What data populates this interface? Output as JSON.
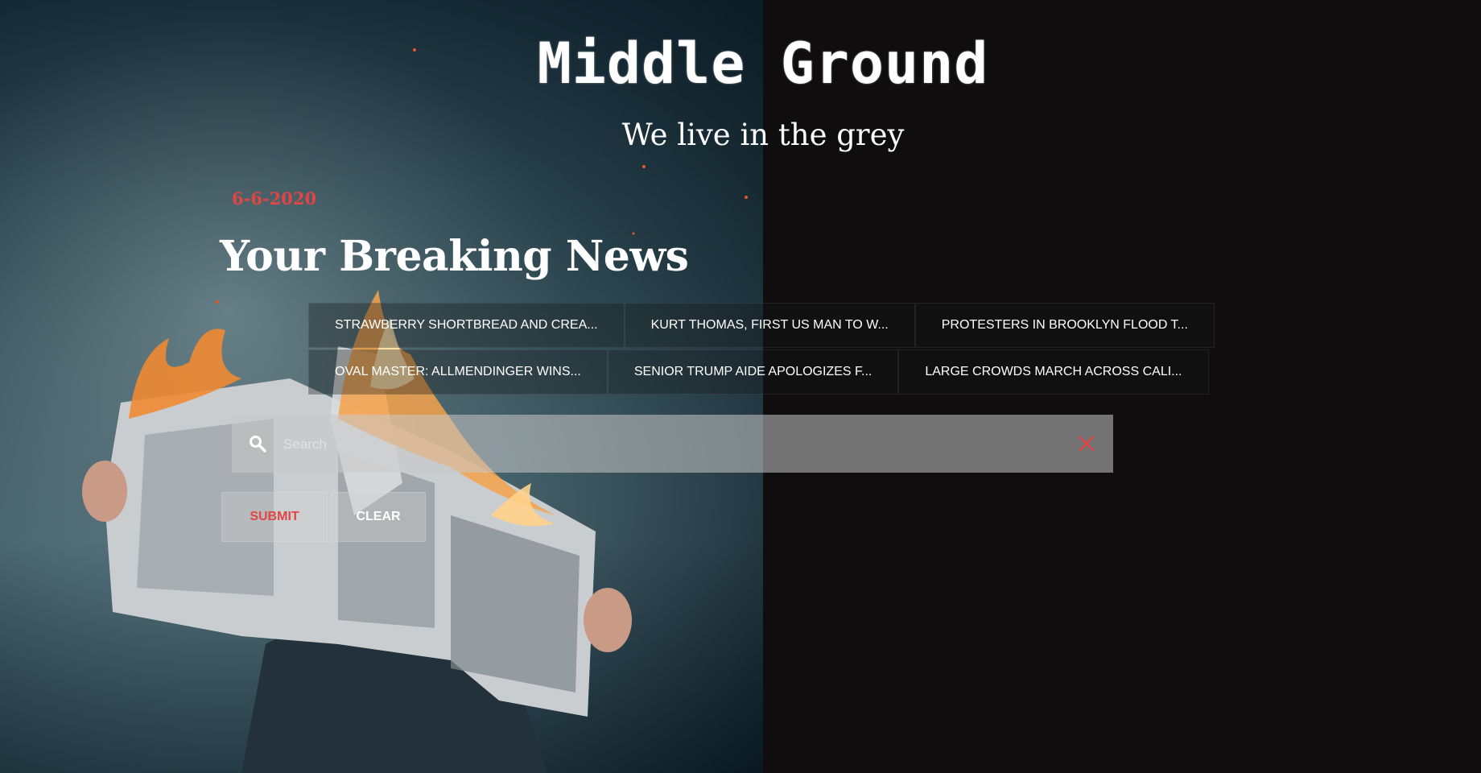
{
  "site": {
    "title": "Middle Ground",
    "subtitle": "We live in the grey"
  },
  "date": "6-6-2020",
  "heading": "Your Breaking News",
  "news": {
    "row1": [
      "STRAWBERRY SHORTBREAD AND CREA...",
      "KURT THOMAS, FIRST US MAN TO W...",
      "PROTESTERS IN BROOKLYN FLOOD T..."
    ],
    "row2": [
      "OVAL MASTER: ALLMENDINGER WINS...",
      "SENIOR TRUMP AIDE APOLOGIZES F...",
      "LARGE CROWDS MARCH ACROSS CALI..."
    ]
  },
  "search": {
    "placeholder": "Search",
    "value": ""
  },
  "buttons": {
    "submit": "SUBMIT",
    "clear": "CLEAR"
  },
  "icons": {
    "search": "search-icon",
    "clear": "close-icon"
  },
  "colors": {
    "accent": "#e14545",
    "background": "#0f0d0e"
  }
}
